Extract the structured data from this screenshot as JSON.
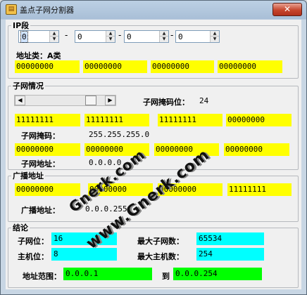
{
  "window": {
    "title": "盖点子网分割器",
    "close_glyph": "✕",
    "icon": "app-icon"
  },
  "ip_group": {
    "legend": "IP段",
    "octets": [
      "0",
      "0",
      "0",
      "0"
    ],
    "separator": "-",
    "class_label": "地址类：A类",
    "binary": [
      "00000000",
      "00000000",
      "00000000",
      "00000000"
    ]
  },
  "subnet_group": {
    "legend": "子网情况",
    "slider_value": 24,
    "mask_bits_label": "子网掩码位：",
    "mask_bits_value": "24",
    "mask_binary": [
      "11111111",
      "11111111",
      "11111111",
      "00000000"
    ],
    "mask_label": "子网掩码：",
    "mask_value": "255.255.255.0",
    "addr_binary": [
      "00000000",
      "00000000",
      "00000000",
      "00000000"
    ],
    "addr_label": "子网地址：",
    "addr_value": "0.0.0.0"
  },
  "broadcast_group": {
    "legend": "广播地址",
    "binary": [
      "00000000",
      "00000000",
      "00000000",
      "11111111"
    ],
    "label": "广播地址：",
    "value": "0.0.0.255"
  },
  "result_group": {
    "legend": "结论",
    "subnet_bits_label": "子网位：",
    "subnet_bits_value": "16",
    "host_bits_label": "主机位：",
    "host_bits_value": "8",
    "max_subnets_label": "最大子网数：",
    "max_subnets_value": "65534",
    "max_hosts_label": "最大主机数：",
    "max_hosts_value": "254",
    "range_label": "地址范围：",
    "range_start": "0.0.0.1",
    "range_to_label": "到",
    "range_end": "0.0.0.254"
  },
  "watermark": [
    "Gnerk.com",
    "www.Gnerk.com"
  ],
  "colors": {
    "binary_fill": "#ffff00",
    "result_fill": "#00ffff",
    "range_fill": "#00ff00"
  }
}
